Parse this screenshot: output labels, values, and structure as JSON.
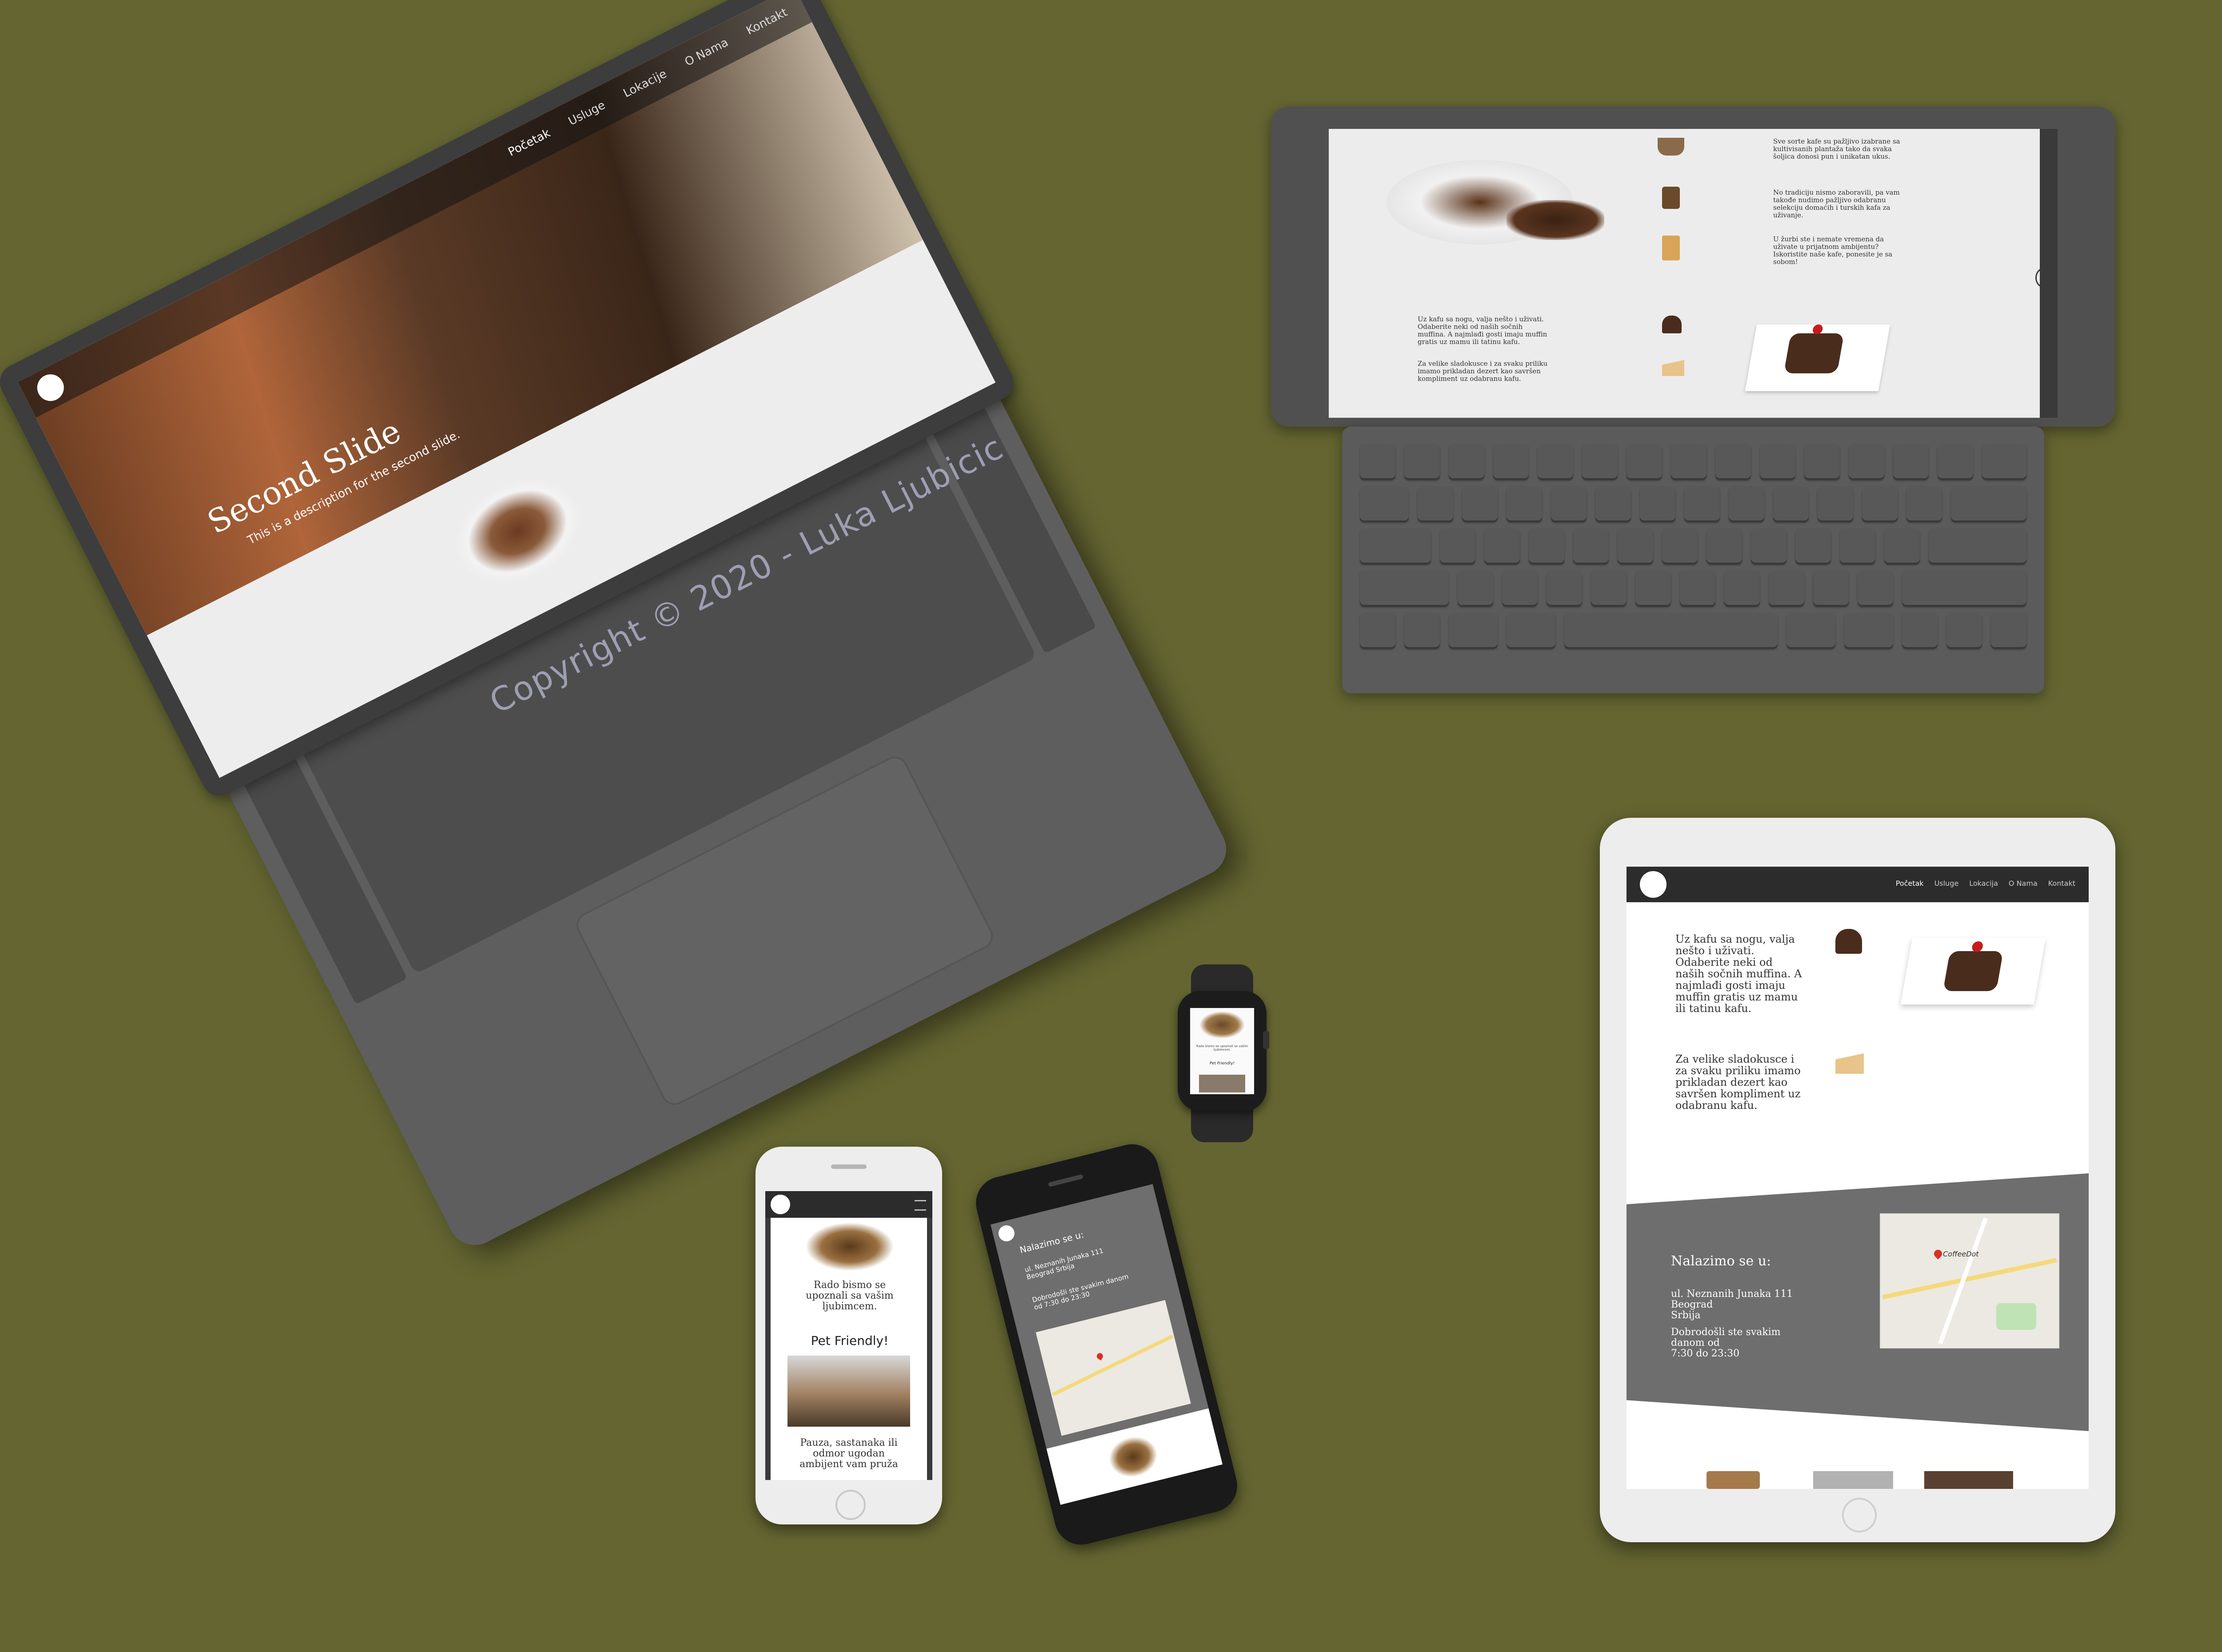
{
  "colors": {
    "background": "#646531",
    "device_dark": "#4a4a4a",
    "device_silver": "#e6e6e6",
    "site_dark": "#3a3a3a",
    "site_gray": "#6e6e6e"
  },
  "watermark": "Copyright © 2020 - Luka Ljubicic",
  "laptop": {
    "nav_items": [
      "Početak",
      "Usluge",
      "Lokacije",
      "O Nama",
      "Kontakt"
    ],
    "slide_title": "Second Slide",
    "slide_caption": "This is a description for the second slide."
  },
  "ipad_keyboard": {
    "paragraphs": [
      "Sve sorte kafe su pažljivo izabrane sa kultivisanih plantaža tako da svaka šoljica donosi pun i unikatan ukus.",
      "No tradiciju nismo zaboravili, pa vam takođe nudimo pažljivo odabranu selekciju domaćih i turskih kafa za uživanje.",
      "U žurbi ste i nemate vremena da uživate u prijatnom ambijentu? Iskoristite naše kafe, ponesite je sa sobom!",
      "Uz kafu sa nogu, valja nešto i uživati. Odaberite neki od naših sočnih muffina. A najmlađi gosti imaju muffin gratis uz mamu ili tatinu kafu.",
      "Za velike sladokusce i za svaku priliku imamo prikladan dezert kao savršen kompliment uz odabranu kafu."
    ]
  },
  "ipad_white": {
    "nav_items": [
      "Početak",
      "Usluge",
      "Lokacija",
      "O Nama",
      "Kontakt"
    ],
    "para1": "Uz kafu sa nogu, valja nešto i uživati. Odaberite neki od naših sočnih muffina. A najmlađi gosti imaju muffin gratis uz mamu ili tatinu kafu.",
    "para2": "Za velike sladokusce i za svaku priliku imamo prikladan dezert kao savršen kompliment uz odabranu kafu.",
    "location_title": "Nalazimo se u:",
    "address": [
      "ul. Neznanih Junaka 111",
      "Beograd",
      "Srbija"
    ],
    "hours": [
      "Dobrodošli ste svakim",
      "danom od",
      "7:30 do 23:30"
    ],
    "map_label": "CoffeeDot"
  },
  "watch": {
    "caption": "Rado bismo se upoznali sa vašim ljubimcem.",
    "heading": "Pet Friendly!"
  },
  "phone_white": {
    "caption": "Rado bismo se upoznali sa vašim ljubimcem.",
    "heading": "Pet Friendly!",
    "body": "Pauza, sastanaka ili odmor ugodan ambijent vam pruža"
  },
  "phone_black": {
    "title": "Nalazimo se u:",
    "address": "ul. Neznanih Junaka 111 Beograd Srbija",
    "hours": "Dobrodošli ste svakim danom od 7:30 do 23:30"
  }
}
